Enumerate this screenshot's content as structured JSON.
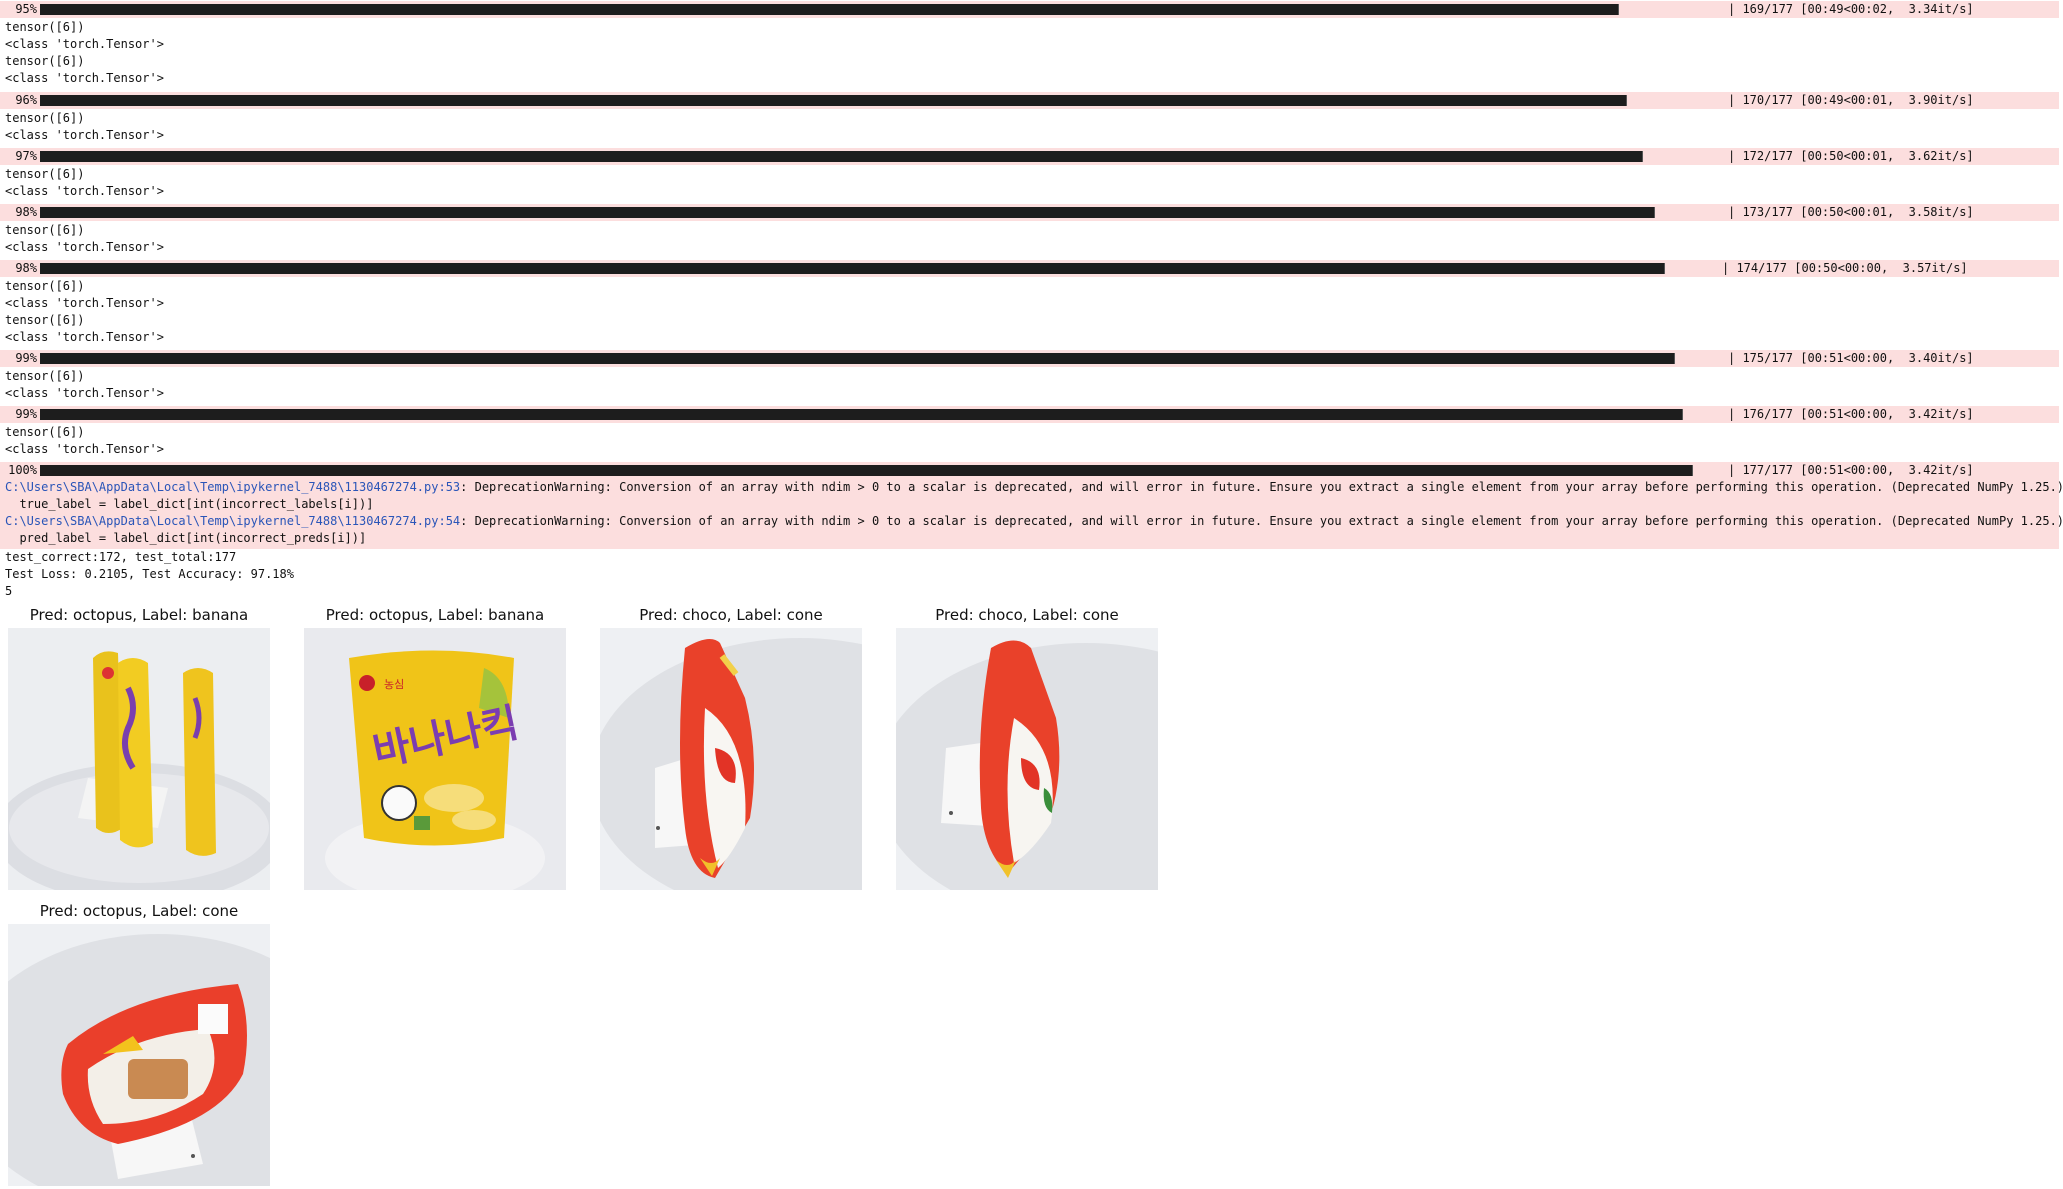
{
  "progress_rows": [
    {
      "pct": "95%",
      "progress": 0.955,
      "stats": "| 169/177 [00:49<00:02,  3.34it/s]"
    },
    {
      "pct": "96%",
      "progress": 0.96,
      "stats": "| 170/177 [00:49<00:01,  3.90it/s]"
    },
    {
      "pct": "97%",
      "progress": 0.97,
      "stats": "| 172/177 [00:50<00:01,  3.62it/s]"
    },
    {
      "pct": "98%",
      "progress": 0.977,
      "stats": "| 173/177 [00:50<00:01,  3.58it/s]"
    },
    {
      "pct": "98%",
      "progress": 0.983,
      "stats": "| 174/177 [00:50<00:00,  3.57it/s]"
    },
    {
      "pct": "99%",
      "progress": 0.989,
      "stats": "| 175/177 [00:51<00:00,  3.40it/s]"
    },
    {
      "pct": "99%",
      "progress": 0.994,
      "stats": "| 176/177 [00:51<00:00,  3.42it/s]"
    },
    {
      "pct": "100%",
      "progress": 1.0,
      "stats": "| 177/177 [00:51<00:00,  3.42it/s]"
    }
  ],
  "output_lines": {
    "tensor": "tensor([6])",
    "class": "<class 'torch.Tensor'>"
  },
  "warnings": [
    {
      "path": "C:\\Users\\SBA\\AppData\\Local\\Temp\\ipykernel_7488\\1130467274.py:53",
      "message": ": DeprecationWarning: Conversion of an array with ndim > 0 to a scalar is deprecated, and will error in future. Ensure you extract a single element from your array before performing this operation. (Deprecated NumPy 1.25.)",
      "code": "  true_label = label_dict[int(incorrect_labels[i])]"
    },
    {
      "path": "C:\\Users\\SBA\\AppData\\Local\\Temp\\ipykernel_7488\\1130467274.py:54",
      "message": ": DeprecationWarning: Conversion of an array with ndim > 0 to a scalar is deprecated, and will error in future. Ensure you extract a single element from your array before performing this operation. (Deprecated NumPy 1.25.)",
      "code": "  pred_label = label_dict[int(incorrect_preds[i])]"
    }
  ],
  "summary": [
    "test_correct:172, test_total:177",
    "Test Loss: 0.2105, Test Accuracy: 97.18%",
    "5"
  ],
  "results": [
    {
      "title": "Pred: octopus, Label: banana",
      "image": "yellow-snack-bags-photo"
    },
    {
      "title": "Pred: octopus, Label: banana",
      "image": "banana-kick-bag-photo"
    },
    {
      "title": "Pred: choco, Label: cone",
      "image": "red-cone-snack-bag-photo"
    },
    {
      "title": "Pred: choco, Label: cone",
      "image": "red-cone-snack-bag-photo"
    },
    {
      "title": "Pred: octopus, Label: cone",
      "image": "red-snack-bag-lying-photo"
    }
  ],
  "bag_text": "바나나킥",
  "colors": {
    "progress_bg": "#fcdede",
    "bar": "#1d1d1d",
    "path_link": "#2a55b8"
  }
}
